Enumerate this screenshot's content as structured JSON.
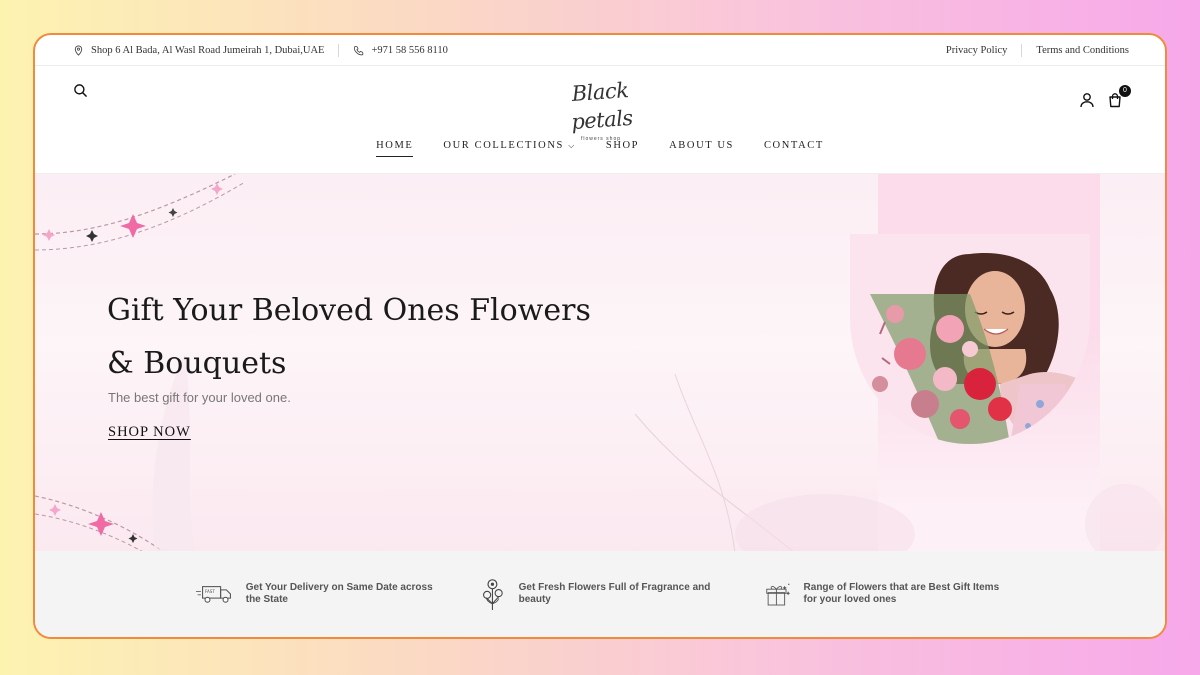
{
  "topbar": {
    "address": "Shop 6 Al Bada, Al Wasl Road Jumeirah 1, Dubai,UAE",
    "phone": "+971 58 556 8110",
    "privacy_label": "Privacy Policy",
    "terms_label": "Terms and Conditions"
  },
  "header": {
    "logo_script": "Black petals",
    "logo_sub": "flowers shop",
    "cart_count": "0"
  },
  "nav": {
    "items": [
      {
        "label": "HOME"
      },
      {
        "label": "OUR COLLECTIONS"
      },
      {
        "label": "SHOP"
      },
      {
        "label": "ABOUT US"
      },
      {
        "label": "CONTACT"
      }
    ]
  },
  "hero": {
    "title": "Gift Your Beloved Ones Flowers & Bouquets",
    "subtitle": "The best gift for your loved one.",
    "cta": "SHOP NOW"
  },
  "features": [
    {
      "icon": "delivery-truck-icon",
      "text": "Get Your Delivery on Same Date across the State"
    },
    {
      "icon": "flower-icon",
      "text": "Get Fresh Flowers Full of Fragrance and beauty"
    },
    {
      "icon": "gift-box-icon",
      "text": "Range of Flowers that are Best Gift Items for your loved ones"
    }
  ],
  "colors": {
    "frame_border": "#f08a3c",
    "accent_pink": "#f06aa6",
    "hero_band": "#fcdcea"
  }
}
